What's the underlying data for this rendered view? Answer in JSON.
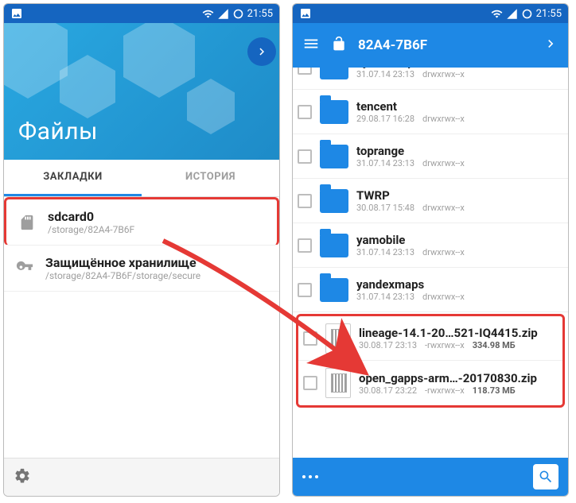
{
  "status": {
    "time": "21:55"
  },
  "screen1": {
    "heroTitle": "Файлы",
    "tabs": {
      "bookmarks": "ЗАКЛАДКИ",
      "history": "ИСТОРИЯ"
    },
    "sdcard": {
      "name": "sdcard0",
      "path": "/storage/82A4-7B6F"
    },
    "secure": {
      "name": "Защищённое хранилище",
      "path": "/storage/82A4-7B6F/storage/secure"
    }
  },
  "screen2": {
    "breadcrumb": "82A4-7B6F",
    "folders": [
      {
        "name": "system_update",
        "date": "31.07.14 23:13",
        "perm": "drwxrwx--x"
      },
      {
        "name": "tencent",
        "date": "29.08.17 16:28",
        "perm": "drwxrwx--x"
      },
      {
        "name": "toprange",
        "date": "31.07.14 23:13",
        "perm": "drwxrwx--x"
      },
      {
        "name": "TWRP",
        "date": "30.08.17 15:48",
        "perm": "drwxrwx--x"
      },
      {
        "name": "yamobile",
        "date": "31.07.14 23:13",
        "perm": "drwxrwx--x"
      },
      {
        "name": "yandexmaps",
        "date": "31.07.14 23:13",
        "perm": "drwxrwx--x"
      }
    ],
    "zips": [
      {
        "name": "lineage-14.1-20…521-IQ4415.zip",
        "date": "30.08.17 23:13",
        "perm": "-rwxrwx--x",
        "size": "334.98 МБ"
      },
      {
        "name": "open_gapps-arm…-20170830.zip",
        "date": "30.08.17 23:22",
        "perm": "-rwxrwx--x",
        "size": "118.73 МБ"
      }
    ]
  }
}
